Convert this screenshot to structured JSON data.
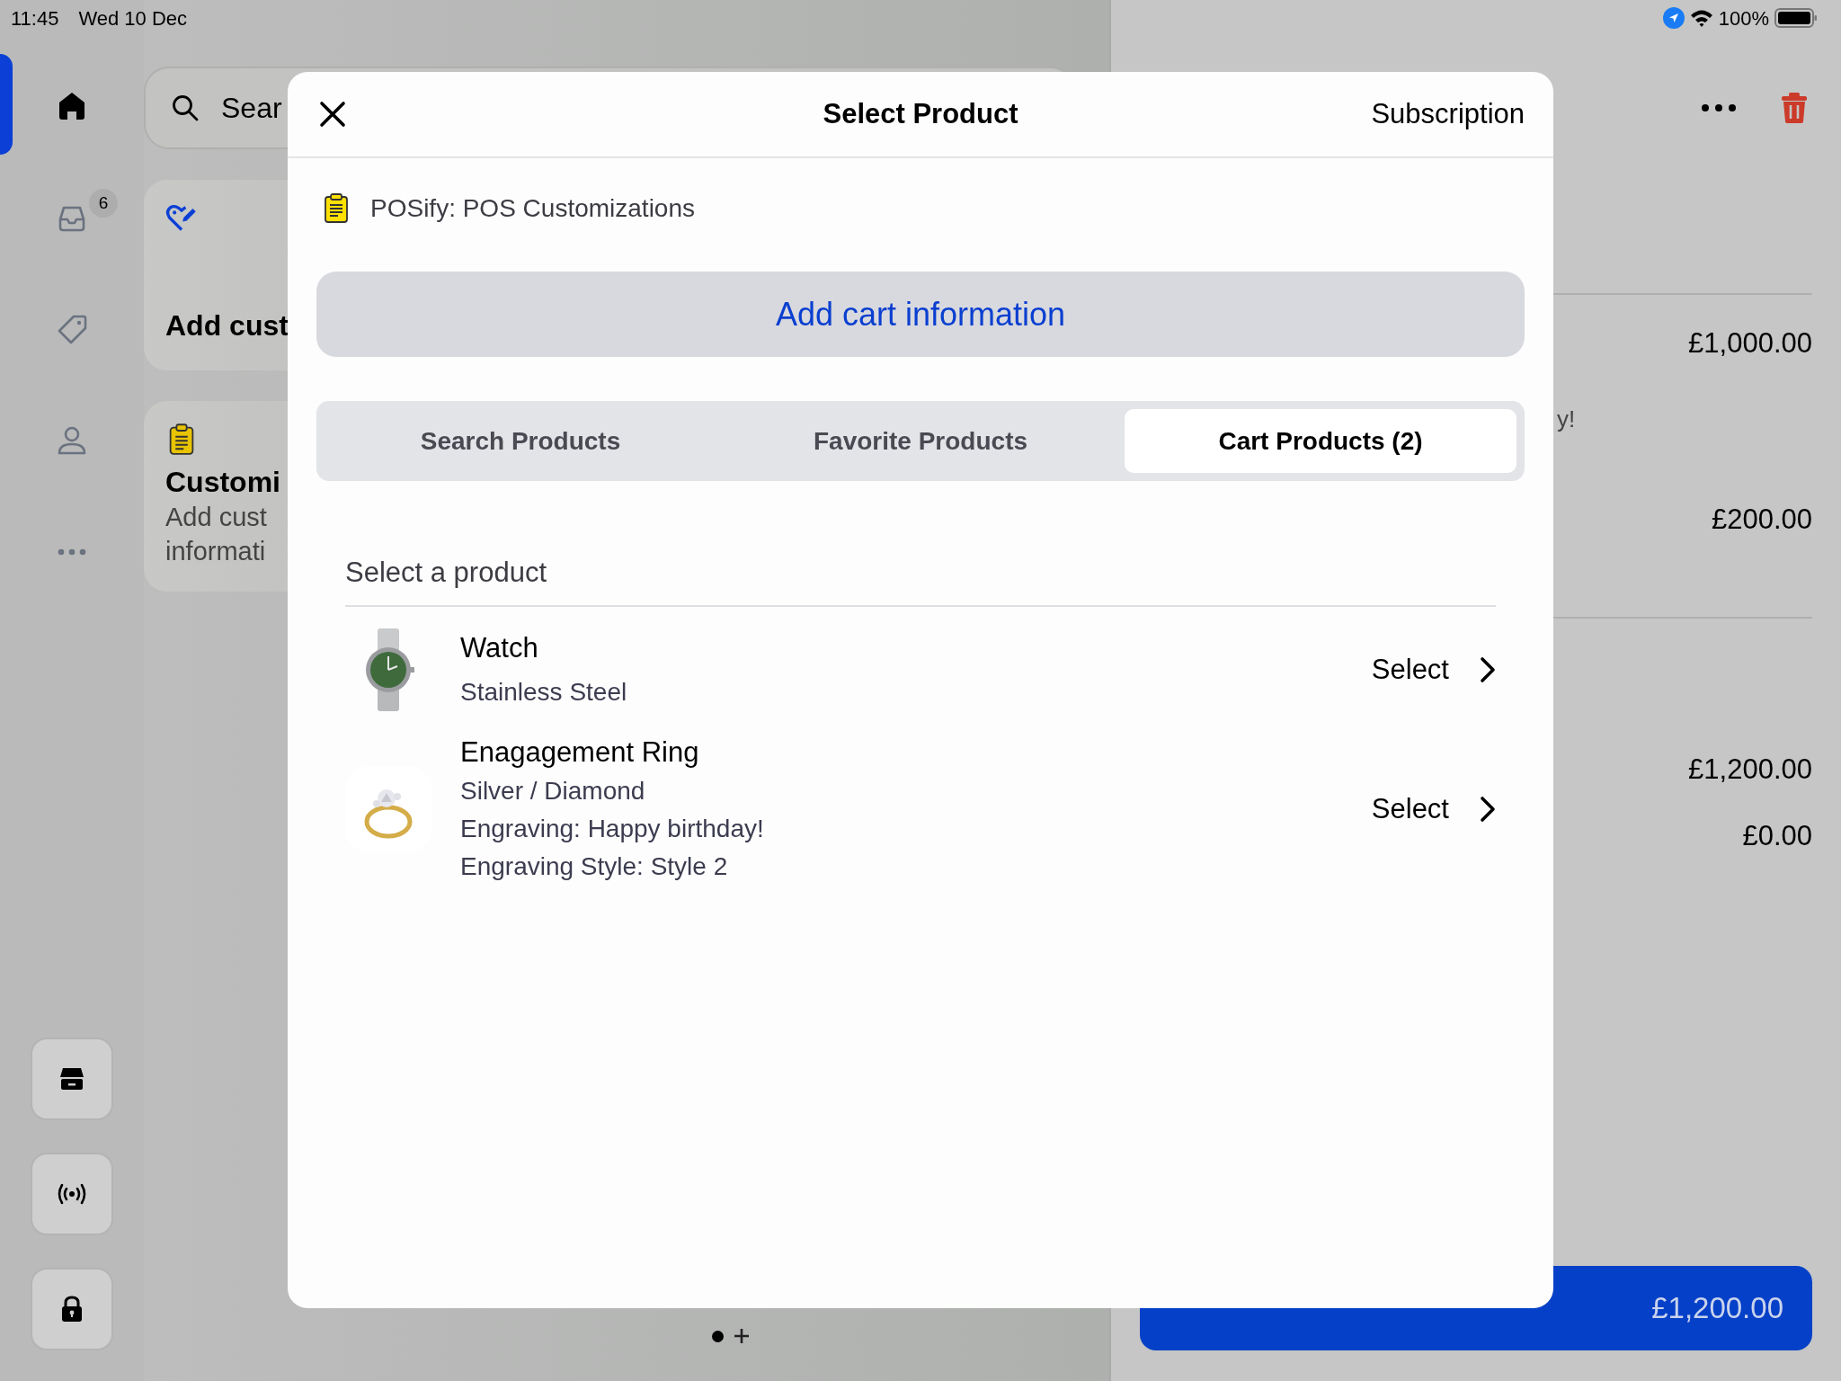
{
  "status_bar": {
    "time": "11:45",
    "date": "Wed 10 Dec",
    "battery": "100%"
  },
  "sidebar": {
    "items": [
      {
        "kind": "home",
        "selected": true
      },
      {
        "kind": "inbox",
        "selected": false,
        "badge": "6"
      },
      {
        "kind": "tag",
        "selected": false
      },
      {
        "kind": "person",
        "selected": false
      },
      {
        "kind": "more",
        "selected": false
      }
    ],
    "bottom_buttons": [
      {
        "kind": "store"
      },
      {
        "kind": "broadcast"
      },
      {
        "kind": "lock"
      }
    ]
  },
  "main": {
    "search": {
      "placeholder": "Sear"
    },
    "cards": [
      {
        "kind": "heart",
        "title": "Add cust"
      },
      {
        "kind": "clipboard",
        "title": "Customi",
        "description": [
          "Add cust",
          "informati"
        ]
      }
    ]
  },
  "cart": {
    "sections": [
      {
        "rows": [
          {
            "kind": "price",
            "text": "£1,000.00"
          },
          {
            "kind": "note",
            "text": "y!"
          },
          {
            "kind": "price",
            "text": "£200.00"
          }
        ]
      },
      {
        "rows": [
          {
            "kind": "price",
            "text": "£1,200.00"
          },
          {
            "kind": "price",
            "text": "£0.00"
          }
        ]
      }
    ],
    "checkout": {
      "total": "£1,200.00"
    }
  },
  "pager": {
    "dots": [
      {
        "selected": true
      }
    ]
  },
  "modal": {
    "title": "Select Product",
    "action": "Subscription",
    "app_label": "POSify: POS Customizations",
    "add_button": "Add cart information",
    "tabs": [
      {
        "label": "Search Products",
        "selected": false
      },
      {
        "label": "Favorite Products",
        "selected": false
      },
      {
        "label": "Cart Products (2)",
        "selected": true
      }
    ],
    "section_title": "Select a product",
    "products": [
      {
        "name": "Watch",
        "details": [
          "Stainless Steel"
        ],
        "action": "Select"
      },
      {
        "name": "Enagagement Ring",
        "details": [
          "Silver / Diamond",
          "Engraving: Happy birthday!",
          "Engraving Style: Style 2"
        ],
        "action": "Select"
      }
    ]
  }
}
